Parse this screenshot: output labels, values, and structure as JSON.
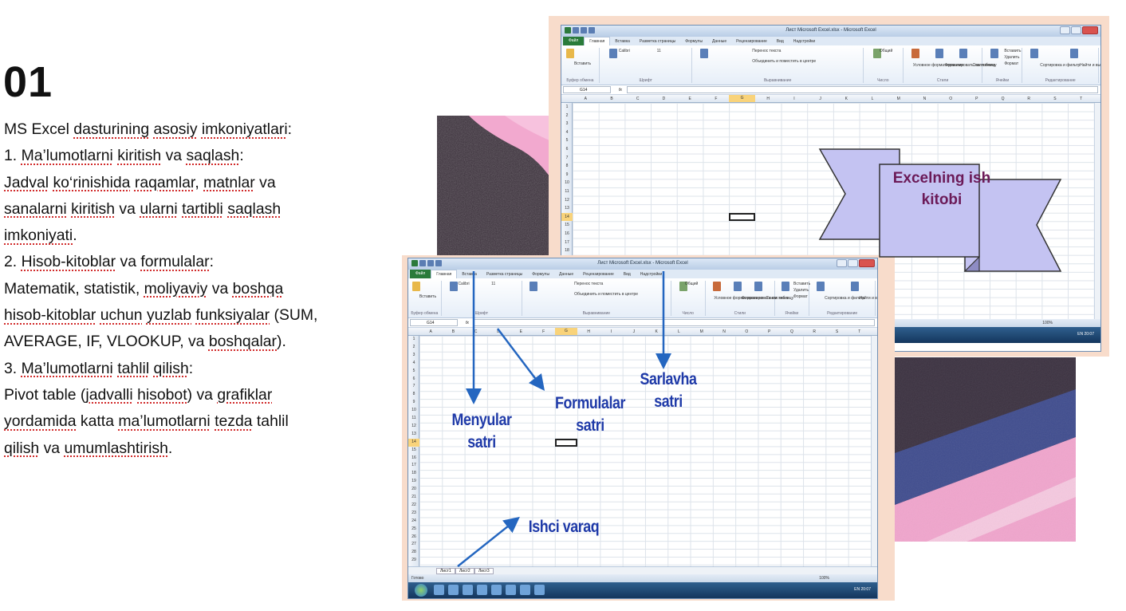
{
  "slide": {
    "number": "01",
    "lines": [
      [
        {
          "t": "MS Excel "
        },
        {
          "t": "dasturining",
          "u": true
        },
        {
          "t": " "
        },
        {
          "t": "asosiy",
          "u": true
        },
        {
          "t": " "
        },
        {
          "t": "imkoniyatlari",
          "u": true
        },
        {
          "t": ":"
        }
      ],
      [
        {
          "t": "1. "
        },
        {
          "t": "Ma’lumotlarni",
          "u": true
        },
        {
          "t": " "
        },
        {
          "t": "kiritish",
          "u": true
        },
        {
          "t": " va "
        },
        {
          "t": "saqlash",
          "u": true
        },
        {
          "t": ":"
        }
      ],
      [
        {
          "t": "Jadval",
          "u": true
        },
        {
          "t": " "
        },
        {
          "t": "ko‘rinishida",
          "u": true
        },
        {
          "t": " "
        },
        {
          "t": "raqamlar",
          "u": true
        },
        {
          "t": ", "
        },
        {
          "t": "matnlar",
          "u": true
        },
        {
          "t": " va"
        }
      ],
      [
        {
          "t": "sanalarni",
          "u": true
        },
        {
          "t": " "
        },
        {
          "t": "kiritish",
          "u": true
        },
        {
          "t": " va "
        },
        {
          "t": "ularni",
          "u": true
        },
        {
          "t": " "
        },
        {
          "t": "tartibli",
          "u": true
        },
        {
          "t": " "
        },
        {
          "t": "saqlash",
          "u": true
        }
      ],
      [
        {
          "t": "imkoniyati",
          "u": true
        },
        {
          "t": "."
        }
      ],
      [
        {
          "t": "2. "
        },
        {
          "t": "Hisob-kitoblar",
          "u": true
        },
        {
          "t": " va "
        },
        {
          "t": "formulalar",
          "u": true
        },
        {
          "t": ":"
        }
      ],
      [
        {
          "t": "Matematik, statistik, "
        },
        {
          "t": "moliyaviy",
          "u": true
        },
        {
          "t": " va "
        },
        {
          "t": "boshqa",
          "u": true
        }
      ],
      [
        {
          "t": "hisob-kitoblar",
          "u": true
        },
        {
          "t": " "
        },
        {
          "t": "uchun",
          "u": true
        },
        {
          "t": " "
        },
        {
          "t": "yuzlab",
          "u": true
        },
        {
          "t": " "
        },
        {
          "t": "funksiyalar",
          "u": true
        },
        {
          "t": " (SUM,"
        }
      ],
      [
        {
          "t": "AVERAGE, IF, VLOOKUP, va "
        },
        {
          "t": "boshqalar",
          "u": true
        },
        {
          "t": ")."
        }
      ],
      [
        {
          "t": "3. "
        },
        {
          "t": "Ma’lumotlarni",
          "u": true
        },
        {
          "t": " "
        },
        {
          "t": "tahlil",
          "u": true
        },
        {
          "t": " "
        },
        {
          "t": "qilish",
          "u": true
        },
        {
          "t": ":"
        }
      ],
      [
        {
          "t": "Pivot table ("
        },
        {
          "t": "jadvalli",
          "u": true
        },
        {
          "t": " "
        },
        {
          "t": "hisobot",
          "u": true
        },
        {
          "t": ") va "
        },
        {
          "t": "grafiklar",
          "u": true
        }
      ],
      [
        {
          "t": "yordamida",
          "u": true
        },
        {
          "t": " katta "
        },
        {
          "t": "ma’lumotlarni",
          "u": true
        },
        {
          "t": " "
        },
        {
          "t": "tezda",
          "u": true
        },
        {
          "t": " tahlil"
        }
      ],
      [
        {
          "t": "qilish",
          "u": true
        },
        {
          "t": " va "
        },
        {
          "t": "umumlashtirish",
          "u": true
        },
        {
          "t": "."
        }
      ]
    ]
  },
  "excel": {
    "window_title": "Лист Microsoft Excel.xlsx - Microsoft Excel",
    "tabs": [
      "Файл",
      "Главная",
      "Вставка",
      "Разметка страницы",
      "Формулы",
      "Данные",
      "Рецензирование",
      "Вид",
      "Надстройки"
    ],
    "name_box": "G14",
    "fx": "fx",
    "columns": [
      "A",
      "B",
      "C",
      "D",
      "E",
      "F",
      "G",
      "H",
      "I",
      "J",
      "K",
      "L",
      "M",
      "N",
      "O",
      "P",
      "Q",
      "R",
      "S",
      "T"
    ],
    "selected_column": "G",
    "selected_row": 14,
    "sheets": [
      "Лист1",
      "Лист2",
      "Лист3"
    ],
    "status": "Готово",
    "zoom": "100%",
    "tray": "EN  20:07",
    "ribbon_labels": {
      "paste": "Вставить",
      "clipboard": "Буфер обмена",
      "font_name": "Calibri",
      "font_size": "11",
      "font": "Шрифт",
      "wrap": "Перенос текста",
      "merge": "Объединить и поместить в центре",
      "alignment": "Выравнивание",
      "number_format": "Общий",
      "number": "Число",
      "conditional": "Условное форматирование",
      "as_table": "Форматировать как таблицу",
      "cell_styles": "Стили ячеек",
      "styles": "Стили",
      "insert": "Вставить",
      "delete": "Удалить",
      "format": "Формат",
      "cells": "Ячейки",
      "sort": "Сортировка и фильтр",
      "find": "Найти и выделить",
      "editing": "Редактирование"
    }
  },
  "annotations": {
    "banner": [
      "Excelning ish",
      "kitobi"
    ],
    "menus": [
      "Menyular",
      "satri"
    ],
    "formulas": [
      "Formulalar",
      "satri"
    ],
    "title_bar": [
      "Sarlavha",
      "satri"
    ],
    "worksheet": "Ishci varaq"
  },
  "colors": {
    "annotation_text": "#1f3aa8",
    "banner_text": "#6b1a58",
    "banner_fill": "#c4c3f2",
    "frame": "#f8dccb",
    "arrow": "#2466c0"
  }
}
